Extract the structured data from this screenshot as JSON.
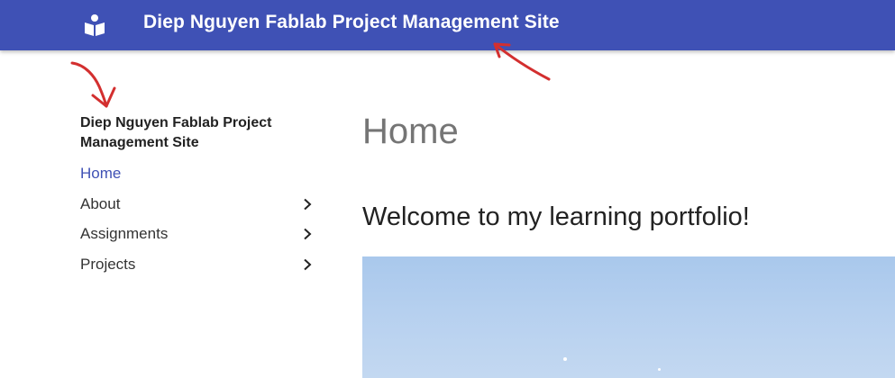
{
  "header": {
    "title": "Diep Nguyen Fablab Project Management Site",
    "logo_icon": "book-reader-icon",
    "background_color": "#3f51b5"
  },
  "sidebar": {
    "site_title": "Diep Nguyen Fablab Project Management Site",
    "items": [
      {
        "label": "Home",
        "active": true,
        "has_children": false
      },
      {
        "label": "About",
        "active": false,
        "has_children": true
      },
      {
        "label": "Assignments",
        "active": false,
        "has_children": true
      },
      {
        "label": "Projects",
        "active": false,
        "has_children": true
      }
    ]
  },
  "main": {
    "page_title": "Home",
    "welcome_heading": "Welcome to my learning portfolio!",
    "hero_image": "sky-photo"
  },
  "annotations": {
    "color": "#d32f2f",
    "arrows": [
      "arrow-to-header-title",
      "arrow-to-sidebar-title"
    ]
  }
}
